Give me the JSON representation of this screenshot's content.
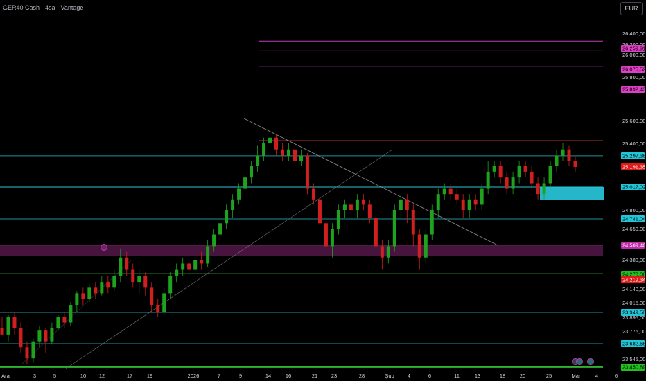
{
  "header": {
    "title": "GER40 Cash · 4sa · Vantage",
    "currency": "EUR"
  },
  "colors": {
    "up": "#26a69a",
    "down": "#ef5350",
    "bull": "#089981",
    "background": "#000000"
  },
  "chart_data": {
    "type": "candlestick",
    "x_ticks": [
      "Ara",
      "3",
      "5",
      "10",
      "12",
      "17",
      "19",
      "2026",
      "7",
      "9",
      "14",
      "16",
      "21",
      "23",
      "28",
      "Şub",
      "4",
      "6",
      "11",
      "13",
      "18",
      "20",
      "25",
      "Mar",
      "4",
      "6"
    ],
    "y_ticks": [
      "26.400,00",
      "26.200,00",
      "26.000,00",
      "25.800,00",
      "25.600,00",
      "25.400,00",
      "24.800,00",
      "24.650,00",
      "24.380,00",
      "24.140,00",
      "24.015,00",
      "23.895,00",
      "23.775,00",
      "23.545,00"
    ],
    "price_levels": [
      {
        "label": "26.259,91",
        "value": 26259.91,
        "kind": "resistance-high"
      },
      {
        "label": "26.075,52",
        "value": 26075.52,
        "kind": "resistance-high"
      },
      {
        "label": "25.892,43",
        "value": 25892.43,
        "kind": "resistance-high"
      },
      {
        "label": "25.297,38",
        "value": 25297.38,
        "kind": "level"
      },
      {
        "label": "25.191,35",
        "value": 25191.35,
        "kind": "last-price"
      },
      {
        "label": "25.017,02",
        "value": 25017.02,
        "kind": "level"
      },
      {
        "label": "24.741,04",
        "value": 24741.04,
        "kind": "level"
      },
      {
        "label": "24.509,46",
        "value": 24509.46,
        "kind": "zone"
      },
      {
        "label": "24.270,08",
        "value": 24270.08,
        "kind": "support"
      },
      {
        "label": "24.219,34",
        "value": 24219.34,
        "kind": "support-low"
      },
      {
        "label": "23.949,58",
        "value": 23949.58,
        "kind": "level"
      },
      {
        "label": "23.682,68",
        "value": 23682.68,
        "kind": "level"
      },
      {
        "label": "23.450,89",
        "value": 23450.89,
        "kind": "support"
      }
    ],
    "candles": [
      [
        23800,
        23750,
        23900,
        23800
      ],
      [
        23750,
        23900,
        23920,
        23700
      ],
      [
        23900,
        23800,
        23950,
        23750
      ],
      [
        23800,
        23650,
        23850,
        23600
      ],
      [
        23650,
        23550,
        23700,
        23480
      ],
      [
        23550,
        23700,
        23720,
        23500
      ],
      [
        23700,
        23780,
        23820,
        23650
      ],
      [
        23780,
        23700,
        23800,
        23600
      ],
      [
        23700,
        23800,
        23850,
        23680
      ],
      [
        23800,
        23900,
        23920,
        23780
      ],
      [
        23900,
        23850,
        23950,
        23800
      ],
      [
        23850,
        24000,
        24020,
        23820
      ],
      [
        24000,
        24100,
        24120,
        23950
      ],
      [
        24100,
        24050,
        24150,
        24000
      ],
      [
        24050,
        24150,
        24180,
        24020
      ],
      [
        24150,
        24100,
        24200,
        24050
      ],
      [
        24100,
        24200,
        24250,
        24080
      ],
      [
        24200,
        24150,
        24250,
        24100
      ],
      [
        24150,
        24250,
        24300,
        24120
      ],
      [
        24250,
        24400,
        24480,
        24200
      ],
      [
        24400,
        24300,
        24450,
        24250
      ],
      [
        24300,
        24200,
        24350,
        24150
      ],
      [
        24200,
        24250,
        24300,
        24100
      ],
      [
        24250,
        24150,
        24280,
        24080
      ],
      [
        24150,
        24000,
        24200,
        23950
      ],
      [
        24000,
        23950,
        24050,
        23900
      ],
      [
        23950,
        24100,
        24150,
        23920
      ],
      [
        24100,
        24250,
        24280,
        24050
      ],
      [
        24250,
        24300,
        24350,
        24200
      ],
      [
        24300,
        24350,
        24400,
        24250
      ],
      [
        24350,
        24300,
        24400,
        24250
      ],
      [
        24300,
        24380,
        24420,
        24280
      ],
      [
        24380,
        24350,
        24450,
        24300
      ],
      [
        24350,
        24500,
        24550,
        24320
      ],
      [
        24500,
        24600,
        24650,
        24450
      ],
      [
        24600,
        24700,
        24750,
        24550
      ],
      [
        24700,
        24800,
        24850,
        24650
      ],
      [
        24800,
        24900,
        24950,
        24750
      ],
      [
        24900,
        25000,
        25050,
        24850
      ],
      [
        25000,
        25100,
        25150,
        24950
      ],
      [
        25100,
        25200,
        25250,
        25050
      ],
      [
        25200,
        25300,
        25380,
        25150
      ],
      [
        25300,
        25400,
        25450,
        25250
      ],
      [
        25400,
        25450,
        25500,
        25350
      ],
      [
        25450,
        25350,
        25480,
        25300
      ],
      [
        25350,
        25300,
        25400,
        25250
      ],
      [
        25300,
        25350,
        25400,
        25250
      ],
      [
        25350,
        25250,
        25380,
        25200
      ],
      [
        25250,
        25300,
        25350,
        25200
      ],
      [
        25300,
        25000,
        25320,
        24950
      ],
      [
        25000,
        24900,
        25050,
        24850
      ],
      [
        24900,
        24700,
        24950,
        24650
      ],
      [
        24700,
        24500,
        24750,
        24450
      ],
      [
        24500,
        24650,
        24700,
        24400
      ],
      [
        24650,
        24800,
        24850,
        24600
      ],
      [
        24800,
        24850,
        24900,
        24750
      ],
      [
        24850,
        24800,
        24900,
        24700
      ],
      [
        24800,
        24900,
        24950,
        24750
      ],
      [
        24900,
        24850,
        24950,
        24800
      ],
      [
        24850,
        24750,
        24900,
        24700
      ],
      [
        24750,
        24500,
        24800,
        24400
      ],
      [
        24500,
        24400,
        24550,
        24300
      ],
      [
        24400,
        24500,
        24550,
        24350
      ],
      [
        24500,
        24800,
        24850,
        24450
      ],
      [
        24800,
        24900,
        24950,
        24750
      ],
      [
        24900,
        24800,
        24950,
        24700
      ],
      [
        24800,
        24600,
        24850,
        24500
      ],
      [
        24600,
        24400,
        24650,
        24300
      ],
      [
        24400,
        24600,
        24650,
        24350
      ],
      [
        24600,
        24800,
        24850,
        24550
      ],
      [
        24800,
        24950,
        25000,
        24750
      ],
      [
        24950,
        25000,
        25050,
        24900
      ],
      [
        25000,
        24950,
        25050,
        24900
      ],
      [
        24950,
        24900,
        25000,
        24850
      ],
      [
        24900,
        24800,
        24950,
        24750
      ],
      [
        24800,
        24900,
        24950,
        24750
      ],
      [
        24900,
        24850,
        24950,
        24800
      ],
      [
        24850,
        25000,
        25050,
        24800
      ],
      [
        25000,
        25150,
        25250,
        24950
      ],
      [
        25150,
        25200,
        25250,
        25100
      ],
      [
        25200,
        25100,
        25250,
        25050
      ],
      [
        25100,
        25000,
        25150,
        24950
      ],
      [
        25000,
        25100,
        25150,
        24950
      ],
      [
        25100,
        25200,
        25250,
        25050
      ],
      [
        25200,
        25150,
        25250,
        25100
      ],
      [
        25150,
        25050,
        25200,
        25000
      ],
      [
        25050,
        24950,
        25100,
        24900
      ],
      [
        24950,
        25050,
        25100,
        24900
      ],
      [
        25050,
        25200,
        25250,
        25000
      ],
      [
        25200,
        25300,
        25350,
        25150
      ],
      [
        25300,
        25350,
        25400,
        25250
      ],
      [
        25350,
        25250,
        25380,
        25200
      ],
      [
        25250,
        25191,
        25300,
        25150
      ]
    ],
    "ylim": [
      23400,
      26600
    ]
  }
}
